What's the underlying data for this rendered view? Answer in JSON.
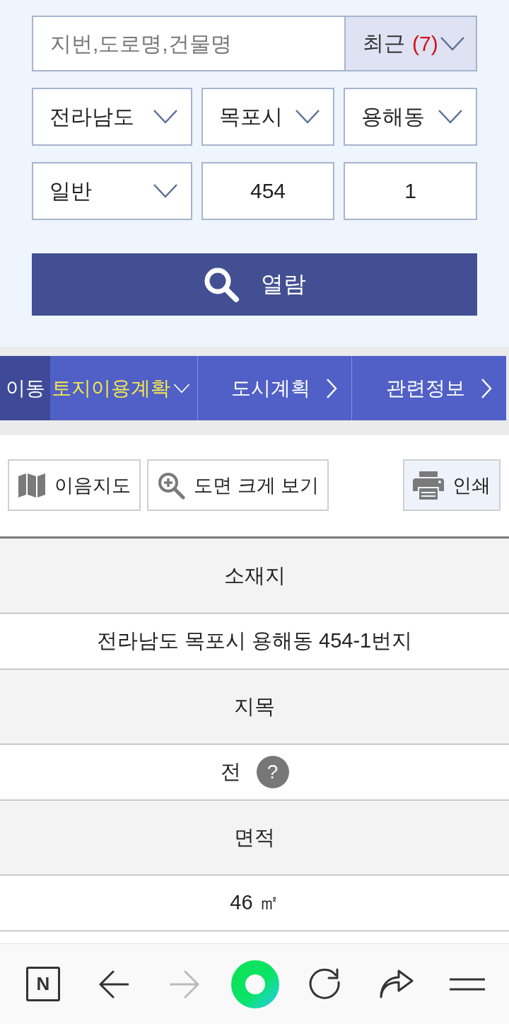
{
  "search": {
    "placeholder": "지번,도로명,건물명",
    "recent": {
      "label": "최근",
      "count": "(7)"
    }
  },
  "address_fields": [
    {
      "kind": "select",
      "value": "전라남도"
    },
    {
      "kind": "select",
      "value": "목포시"
    },
    {
      "kind": "select",
      "value": "용해동"
    },
    {
      "kind": "select",
      "value": "일반"
    },
    {
      "kind": "input",
      "value": "454"
    },
    {
      "kind": "input",
      "value": "1"
    }
  ],
  "view_button": {
    "label": "열람"
  },
  "nav": {
    "label": "이동",
    "tabs": [
      {
        "label": "토지이용계확",
        "selected": true
      },
      {
        "label": "도시계획",
        "selected": false
      },
      {
        "label": "관련정보",
        "selected": false
      }
    ]
  },
  "tools": [
    {
      "kind": "map",
      "label": "이음지도"
    },
    {
      "kind": "zoom",
      "label": "도면 크게 보기"
    },
    {
      "kind": "print",
      "label": "인쇄"
    }
  ],
  "land_info": [
    {
      "label": "소재지",
      "value": "전라남도 목포시 용해동 454-1번지"
    },
    {
      "label": "지목",
      "value": "전",
      "help": "?"
    },
    {
      "label": "면적",
      "value": "46 ㎡"
    }
  ],
  "browser_toolbar": {
    "logo": "N",
    "buttons": [
      {
        "kind": "back",
        "disabled": false
      },
      {
        "kind": "forward",
        "disabled": true
      },
      {
        "kind": "ring",
        "disabled": false
      },
      {
        "kind": "reload",
        "disabled": false
      },
      {
        "kind": "share",
        "disabled": false
      },
      {
        "kind": "menu",
        "disabled": false
      }
    ]
  }
}
